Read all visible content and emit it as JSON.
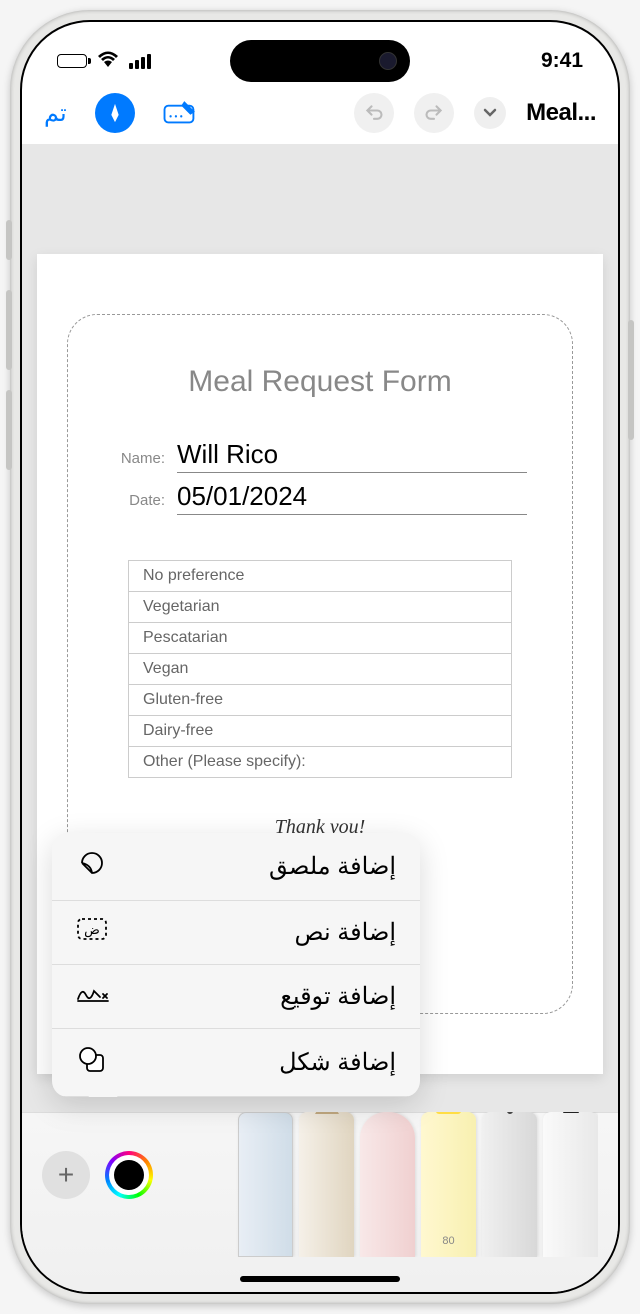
{
  "status_bar": {
    "time": "9:41"
  },
  "toolbar": {
    "done_label": "تم",
    "title": "Meal..."
  },
  "document": {
    "form_title": "Meal Request Form",
    "name_label": "Name:",
    "name_value": "Will Rico",
    "date_label": "Date:",
    "date_value": "05/01/2024",
    "options": [
      "No preference",
      "Vegetarian",
      "Pescatarian",
      "Vegan",
      "Gluten-free",
      "Dairy-free",
      "Other (Please specify):"
    ],
    "thank_you": "Thank you!"
  },
  "popover": {
    "items": [
      {
        "label": "إضافة ملصق",
        "action": "add-sticker"
      },
      {
        "label": "إضافة نص",
        "action": "add-text"
      },
      {
        "label": "إضافة توقيع",
        "action": "add-signature"
      },
      {
        "label": "إضافة شكل",
        "action": "add-shape"
      }
    ]
  },
  "palette": {
    "highlighter_opacity": "80"
  }
}
